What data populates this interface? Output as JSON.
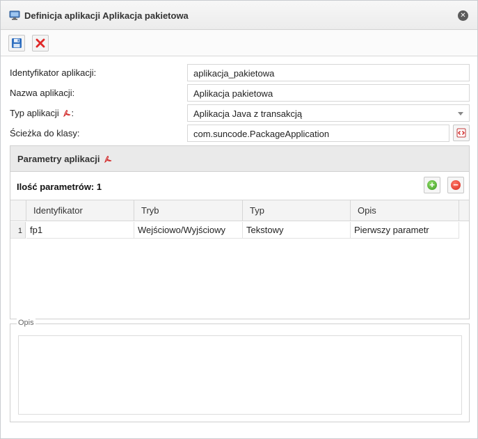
{
  "window": {
    "title": "Definicja aplikacji Aplikacja pakietowa",
    "title_icon": "monitor-icon",
    "close_icon": "close-icon"
  },
  "toolbar": {
    "save_icon": "floppy-disk-icon",
    "cancel_icon": "red-x-icon"
  },
  "form": {
    "id_label": "Identyfikator aplikacji:",
    "id_value": "aplikacja_pakietowa",
    "name_label": "Nazwa aplikacji:",
    "name_value": "Aplikacja pakietowa",
    "type_label": "Typ aplikacji",
    "type_label_suffix": ":",
    "type_value": "Aplikacja Java z transakcją",
    "class_label": "Ścieżka do klasy:",
    "class_value": "com.suncode.PackageApplication"
  },
  "params": {
    "header_title": "Parametry aplikacji",
    "count_label": "Ilość parametrów: 1",
    "columns": [
      "Identyfikator",
      "Tryb",
      "Typ",
      "Opis"
    ],
    "rows": [
      {
        "num": "1",
        "id": "fp1",
        "mode": "Wejściowo/Wyjściowy",
        "type": "Tekstowy",
        "desc": "Pierwszy parametr"
      }
    ]
  },
  "opis": {
    "legend": "Opis",
    "value": ""
  },
  "colors": {
    "accent_add": "#3b9a1e",
    "accent_remove": "#d7281c",
    "pdf_red": "#d22a2a"
  }
}
